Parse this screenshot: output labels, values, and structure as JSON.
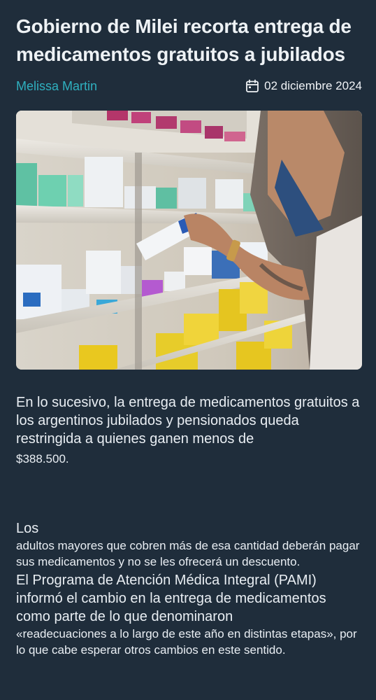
{
  "article": {
    "title": "Gobierno de Milei recorta entrega de medicamentos gratuitos a jubilados",
    "author": "Melissa Martin",
    "date": "02 diciembre 2024",
    "date_icon": "calendar-icon",
    "image_alt": "Mano tomando una caja de medicamentos de un estante de farmacia",
    "paragraphs": [
      "En lo sucesivo, la entrega de medicamentos gratuitos a los argentinos jubilados y pensionados queda restringida a quienes ganen menos de",
      "$388.500.",
      "Los",
      "adultos mayores que cobren más de esa cantidad deberán pagar sus medicamentos y no se les ofrecerá un descuento.",
      "El Programa de Atención Médica Integral (PAMI) informó el cambio en la entrega de medicamentos como parte de lo que denominaron",
      "«readecuaciones a lo largo de este año en distintas etapas», por lo que cabe esperar otros cambios en este sentido."
    ]
  },
  "colors": {
    "background": "#1f2d3b",
    "author": "#2fb0bf",
    "text": "#e9eef3"
  }
}
